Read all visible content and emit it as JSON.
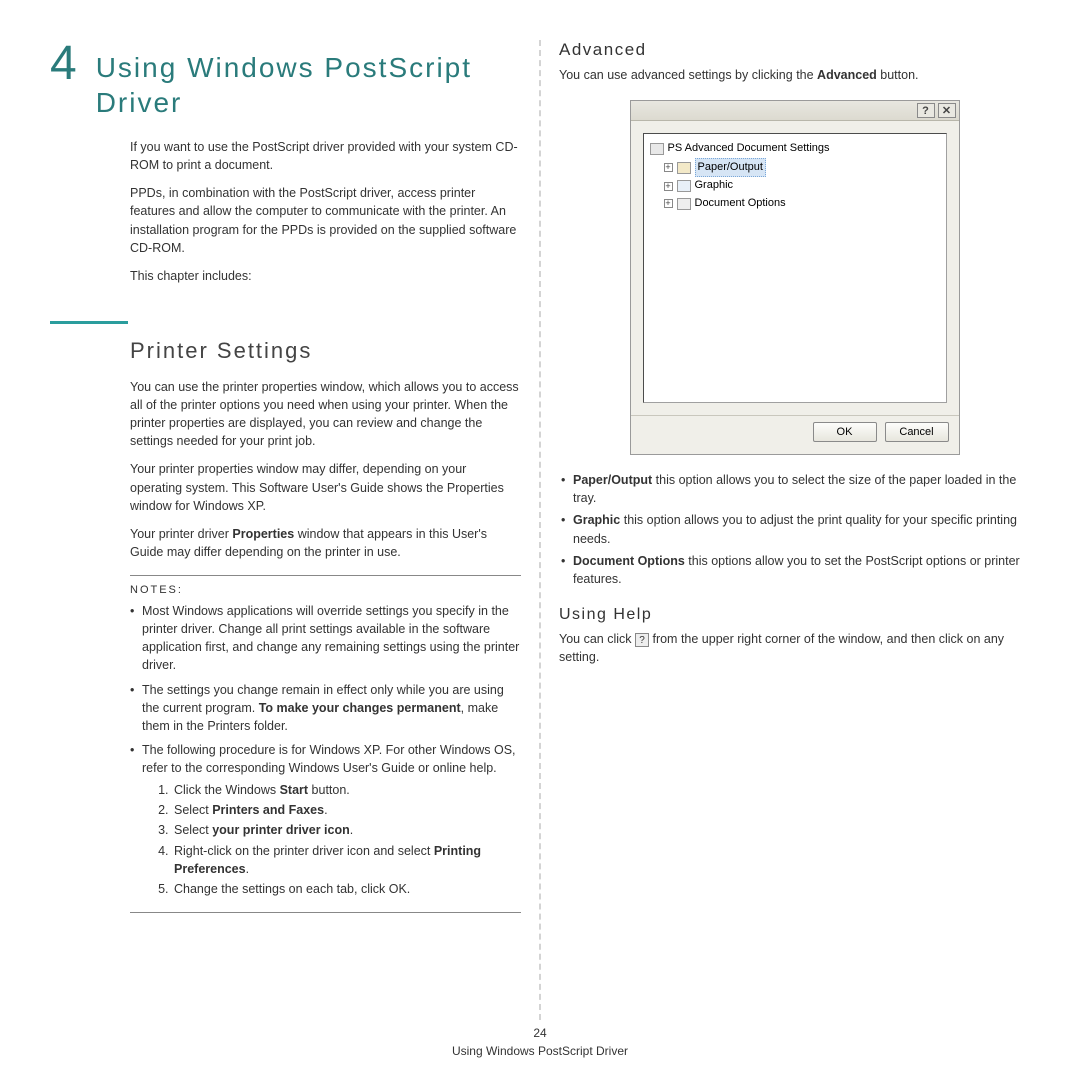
{
  "chapter": {
    "number": "4",
    "title": "Using Windows PostScript Driver"
  },
  "intro": {
    "p1": "If you want to use the PostScript driver provided with your system CD-ROM to print a document.",
    "p2": "PPDs, in combination with the PostScript driver, access printer features and allow the computer to communicate with the printer. An installation program for the PPDs is provided on the supplied software CD-ROM.",
    "p3": "This chapter includes:"
  },
  "section_printer": {
    "title": "Printer Settings",
    "p1": "You can use the printer properties window, which allows you to access all of the printer options you need when using your printer. When the printer properties are displayed, you can review and change the settings needed for your print job.",
    "p2": "Your printer properties window may differ, depending on your operating system. This Software User's Guide shows the Properties window for Windows XP.",
    "p3_a": "Your printer driver ",
    "p3_b": "Properties",
    "p3_c": " window that appears in this User's Guide may differ depending on the printer in use."
  },
  "notes": {
    "label": "NOTES:",
    "n1": "Most Windows applications will override settings you specify in the printer driver. Change all print settings available in the software application first, and change any remaining settings using the printer driver.",
    "n2_a": "The settings you change remain in effect only while you are using the current program. ",
    "n2_b": "To make your changes permanent",
    "n2_c": ", make them in the Printers folder.",
    "n3_intro": "The following procedure is for Windows XP. For other Windows OS, refer to the corresponding Windows User's Guide or online help.",
    "s1_a": "Click the Windows ",
    "s1_b": "Start",
    "s1_c": " button.",
    "s2_a": "Select ",
    "s2_b": "Printers and Faxes",
    "s2_c": ".",
    "s3_a": "Select ",
    "s3_b": "your printer driver icon",
    "s3_c": ".",
    "s4_a": "Right-click on the printer driver icon and select ",
    "s4_b": "Printing Preferences",
    "s4_c": ".",
    "s5": "Change the settings on each tab, click OK."
  },
  "advanced": {
    "title": "Advanced",
    "p1_a": "You can use advanced settings by clicking the ",
    "p1_b": "Advanced",
    "p1_c": " button.",
    "b1_a": "Paper/Output",
    "b1_b": " this option allows you to select the size of the paper loaded in the tray.",
    "b2_a": "Graphic",
    "b2_b": " this option allows you to adjust the print quality for your specific printing needs.",
    "b3_a": "Document Options",
    "b3_b": " this options allow you to set the PostScript options or printer features."
  },
  "dialog": {
    "help": "?",
    "close": "✕",
    "root": "PS Advanced Document Settings",
    "item1": "Paper/Output",
    "item2": "Graphic",
    "item3": "Document Options",
    "ok": "OK",
    "cancel": "Cancel"
  },
  "usinghelp": {
    "title": "Using Help",
    "p_a": "You can click ",
    "p_b": " from the upper right corner of the window, and then click on any setting.",
    "icon": "?"
  },
  "footer": {
    "page": "24",
    "title": "Using Windows PostScript Driver"
  }
}
